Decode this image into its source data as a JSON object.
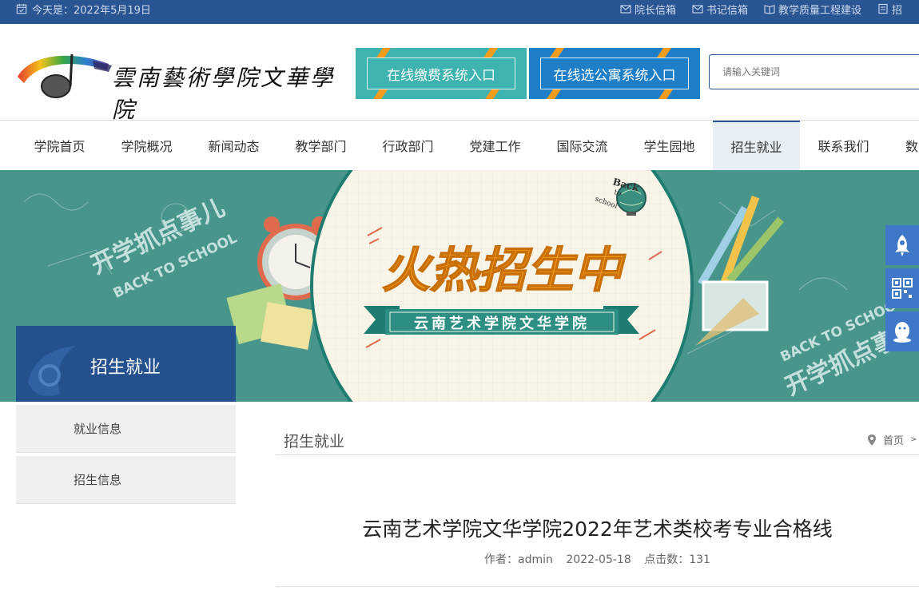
{
  "topbar": {
    "date_text": "今天是：2022年5月19日",
    "links": [
      {
        "label": "院长信箱",
        "icon": "mail-icon"
      },
      {
        "label": "书记信箱",
        "icon": "mail-icon"
      },
      {
        "label": "教学质量工程建设",
        "icon": "book-icon"
      },
      {
        "label": "招",
        "icon": "document-icon"
      }
    ]
  },
  "header": {
    "school_name": "雲南藝術學院文華學院",
    "entries": [
      {
        "label": "在线缴费系统入口"
      },
      {
        "label": "在线选公寓系统入口"
      }
    ],
    "search": {
      "placeholder": "请输入关键词"
    }
  },
  "nav": {
    "items": [
      "学院首页",
      "学院概况",
      "新闻动态",
      "教学部门",
      "行政部门",
      "党建工作",
      "国际交流",
      "学生园地",
      "招生就业",
      "联系我们",
      "数"
    ],
    "active_index": 8
  },
  "banner": {
    "headline": "火热招生中",
    "ribbon": "云南艺术学院文华学院",
    "left_slogan_cn": "开学抓点事儿",
    "slogan_en": "BACK TO SCHOOL",
    "badge_line1": "Back",
    "badge_line2": "to",
    "badge_line3": "school",
    "section_label": "招生就业"
  },
  "sidebar": {
    "items": [
      "就业信息",
      "招生信息"
    ]
  },
  "content": {
    "section_title": "招生就业",
    "breadcrumb_home": "首页",
    "breadcrumb_sep": ">",
    "article_title": "云南艺术学院文华学院2022年艺术类校考专业合格线",
    "author": "作者：admin",
    "date": "2022-05-18",
    "views": "点击数：131"
  },
  "colors": {
    "primary": "#2a5593",
    "accent_teal": "#3eb3b0",
    "accent_blue": "#1e7ec8",
    "banner_orange": "#f39b1a"
  }
}
